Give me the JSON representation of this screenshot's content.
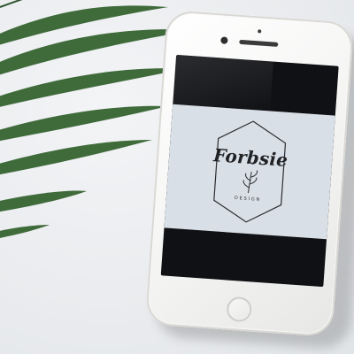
{
  "scene": {
    "wall_color": "#eceef0",
    "leaf_color": "#3f6b3b"
  },
  "phone": {
    "screen_logo": {
      "brand": "Forbsie",
      "sub": "DESIGN",
      "logo_bg": "#d9dfe6",
      "ink": "#1f2125"
    }
  }
}
